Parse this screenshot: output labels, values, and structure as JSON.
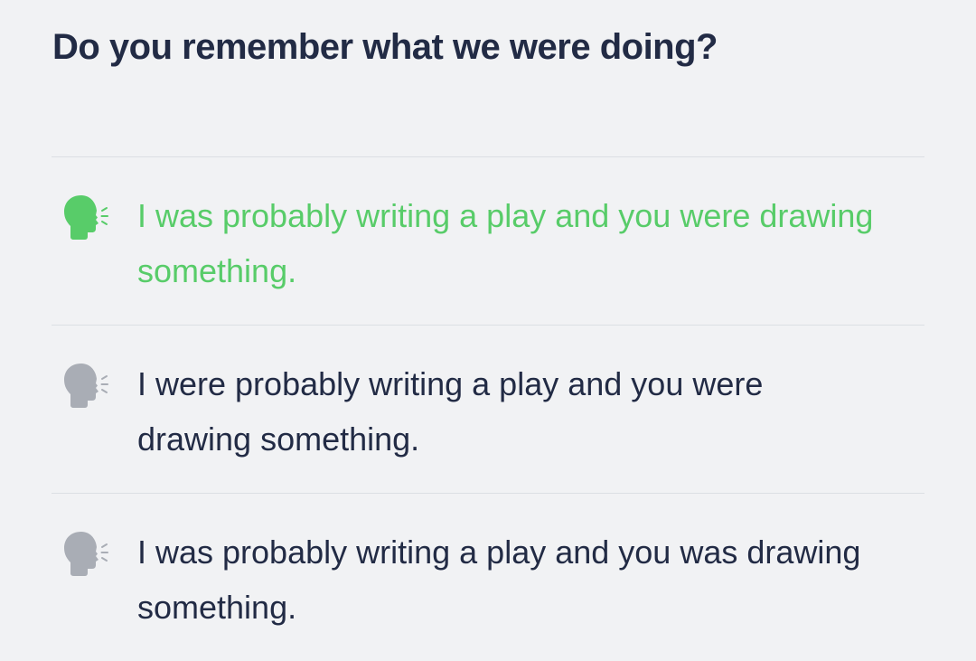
{
  "question": {
    "text": "Do you remember what we were doing?"
  },
  "options": [
    {
      "text": "I was probably writing a play and you were drawing something.",
      "state": "correct",
      "icon": "speaking-head-icon",
      "color": "#58cc69"
    },
    {
      "text": "I were probably writing a play and you were drawing something.",
      "state": "default",
      "icon": "speaking-head-icon",
      "color": "#a9adb5"
    },
    {
      "text": "I was probably writing a play and you was drawing something.",
      "state": "default",
      "icon": "speaking-head-icon",
      "color": "#a9adb5"
    }
  ],
  "colors": {
    "background": "#f1f2f4",
    "text": "#222b45",
    "correct": "#58cc69",
    "icon_inactive": "#a9adb5",
    "divider": "#dcdfe4"
  }
}
